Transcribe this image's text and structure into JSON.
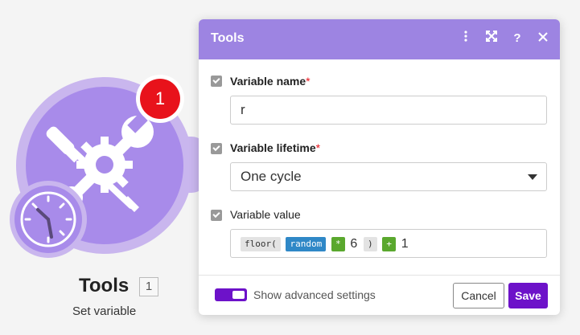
{
  "module": {
    "title": "Tools",
    "id": "1",
    "subtitle": "Set variable",
    "badge": "1",
    "icon": "tools-icon",
    "overlay_icon": "clock-icon",
    "color": "#a88bea"
  },
  "panel": {
    "title": "Tools",
    "header_icons": [
      "more-vertical-icon",
      "expand-icon",
      "help-icon",
      "close-icon"
    ],
    "header_color": "#9d84e2",
    "fields": [
      {
        "label": "Variable name",
        "required": "*",
        "value": "r"
      },
      {
        "label": "Variable lifetime",
        "required": "*",
        "value": "One cycle"
      },
      {
        "label": "Variable value",
        "tokens": [
          {
            "text": "floor(",
            "style": "gray"
          },
          {
            "text": "random",
            "style": "blue"
          },
          {
            "text": "*",
            "style": "green"
          },
          {
            "text": "6",
            "style": "plain"
          },
          {
            "text": ")",
            "style": "gray"
          },
          {
            "text": "+",
            "style": "green"
          },
          {
            "text": "1",
            "style": "plain"
          }
        ]
      }
    ],
    "footer": {
      "toggle_label": "Show advanced settings",
      "toggle_on": true,
      "cancel_label": "Cancel",
      "save_label": "Save",
      "accent": "#6d12c9"
    }
  }
}
